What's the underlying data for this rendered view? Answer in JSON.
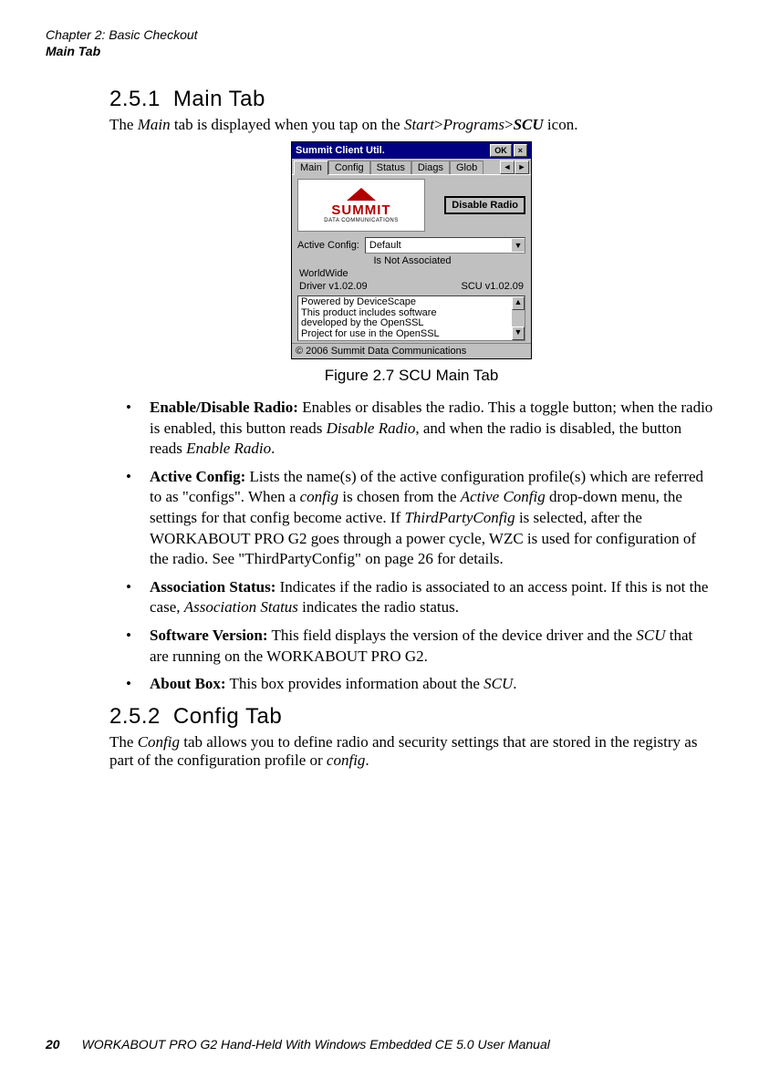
{
  "running_head": {
    "chapter": "Chapter 2: Basic Checkout",
    "section": "Main Tab"
  },
  "sec251": {
    "num": "2.5.1",
    "title": "Main Tab",
    "lead_pre": "The ",
    "lead_it1": "Main",
    "lead_mid1": " tab is displayed when you tap on the ",
    "lead_it2": "Start",
    "lead_gt1": ">",
    "lead_it3": "Programs",
    "lead_gt2": ">",
    "lead_itb": "SCU",
    "lead_post": " icon."
  },
  "ce": {
    "title": "Summit Client Util.",
    "ok": "OK",
    "close": "×",
    "tabs": [
      "Main",
      "Config",
      "Status",
      "Diags",
      "Glob"
    ],
    "tab_scroll_left": "◄",
    "tab_scroll_right": "►",
    "logo_text": "SUMMIT",
    "logo_sub": "DATA COMMUNICATIONS",
    "button_disable": "Disable Radio",
    "active_label": "Active Config:",
    "active_value": "Default",
    "assoc_status": "Is Not Associated",
    "worldwide": "WorldWide",
    "driver": "Driver v1.02.09",
    "scu": "SCU v1.02.09",
    "about1": "Powered by DeviceScape",
    "about2": "This product includes software",
    "about3": "developed by the OpenSSL",
    "about4": "Project for use in the OpenSSL",
    "footer": "© 2006 Summit Data Communications",
    "up": "▲",
    "down": "▼"
  },
  "figcap": "Figure 2.7 SCU Main Tab",
  "bullets": {
    "b1_head": "Enable/Disable Radio:",
    "b1_t1": " Enables or disables the radio. This a toggle button; when the radio is enabled, this button reads ",
    "b1_i1": "Disable Radio",
    "b1_t2": ", and when the radio is disabled, the button reads ",
    "b1_i2": "Enable Radio",
    "b1_t3": ".",
    "b2_head": "Active Config:",
    "b2_t1": " Lists the name(s) of the active configuration profile(s) which are referred to as \"configs\". When a ",
    "b2_i1": "config",
    "b2_t2": " is chosen from the ",
    "b2_i2": "Active Config",
    "b2_t3": " drop-down menu, the settings for that config become active. If ",
    "b2_i3": "ThirdPartyConfig",
    "b2_t4": " is selected, after the WORKABOUT PRO G2 goes through a power cycle, WZC is used for configuration of the radio. See \"ThirdPartyConfig\" on page 26 for details.",
    "b3_head": "Association Status:",
    "b3_t1": " Indicates if the radio is associated to an access point. If this is not the case, ",
    "b3_i1": "Association Status",
    "b3_t2": " indicates the radio status.",
    "b4_head": "Software Version:",
    "b4_t1": " This field displays the version of the device driver and the ",
    "b4_i1": "SCU",
    "b4_t2": " that are running on the WORKABOUT PRO G2.",
    "b5_head": "About Box:",
    "b5_t1": " This box provides information about the ",
    "b5_i1": "SCU",
    "b5_t2": "."
  },
  "sec252": {
    "num": "2.5.2",
    "title": "Config Tab",
    "p_pre": "The ",
    "p_i1": "Config",
    "p_mid": " tab allows you to define radio and security settings that are stored in the registry as part of the configuration profile or ",
    "p_i2": "config",
    "p_post": "."
  },
  "footer": {
    "pageno": "20",
    "book": "WORKABOUT PRO G2 Hand-Held With Windows Embedded CE 5.0 User Manual"
  }
}
